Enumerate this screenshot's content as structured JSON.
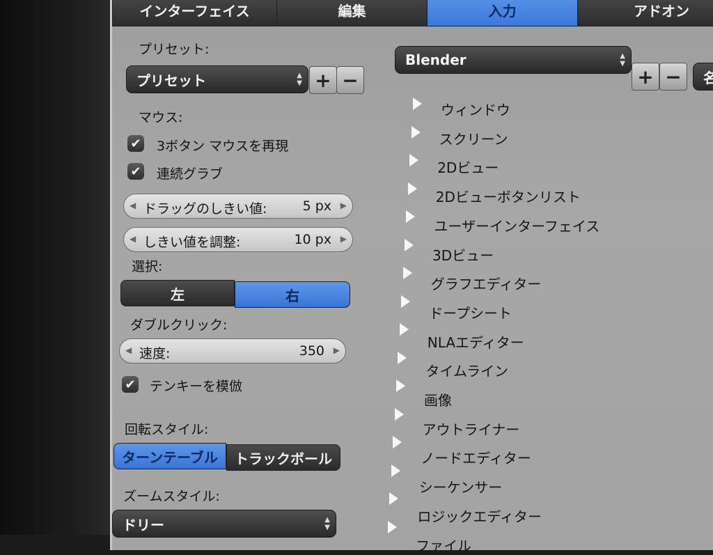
{
  "tabs": [
    "インターフェイス",
    "編集",
    "入力",
    "アドオン"
  ],
  "preset": {
    "section_label": "プリセット:",
    "dropdown_value": "プリセット",
    "add": "+",
    "remove": "−"
  },
  "mouse": {
    "section_label": "マウス:",
    "emulate_3button": {
      "label": "3ボタン マウスを再現",
      "checked": true
    },
    "continuous_grab": {
      "label": "連続グラブ",
      "checked": true
    },
    "drag_threshold": {
      "label": "ドラッグのしきい値:",
      "value": "5 px"
    },
    "tweak_threshold": {
      "label": "しきい値を調整:",
      "value": "10 px"
    }
  },
  "select": {
    "section_label": "選択:",
    "options": [
      "左",
      "右"
    ],
    "selected": "右"
  },
  "double_click": {
    "section_label": "ダブルクリック:",
    "speed_label": "速度:",
    "speed_value": "350"
  },
  "numpad": {
    "label": "テンキーを模倣",
    "checked": true
  },
  "rotation": {
    "section_label": "回転スタイル:",
    "options": [
      "ターンテーブル",
      "トラックボール"
    ],
    "selected": "ターンテーブル"
  },
  "zoom": {
    "section_label": "ズームスタイル:",
    "value": "ドリー"
  },
  "keymap": {
    "dropdown_value": "Blender",
    "add": "+",
    "remove": "−",
    "partial_button": "名",
    "items": [
      "ウィンドウ",
      "スクリーン",
      "2Dビュー",
      "2Dビューボタンリスト",
      "ユーザーインターフェイス",
      "3Dビュー",
      "グラフエディター",
      "ドープシート",
      "NLAエディター",
      "タイムライン",
      "画像",
      "アウトライナー",
      "ノードエディター",
      "シーケンサー",
      "ロジックエディター",
      "ファイル"
    ]
  },
  "colors": {
    "accent": "#4a86e0",
    "panel": "#a3a3a3",
    "widget_dark": "#2e2e2e"
  }
}
